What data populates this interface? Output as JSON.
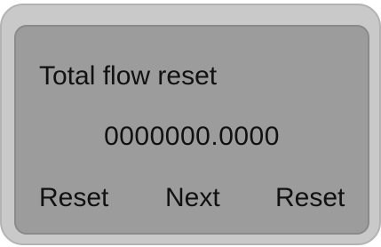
{
  "screen": {
    "title": "Total flow reset",
    "value": "0000000.0000"
  },
  "softkeys": {
    "left": "Reset",
    "middle": "Next",
    "right": "Reset"
  }
}
